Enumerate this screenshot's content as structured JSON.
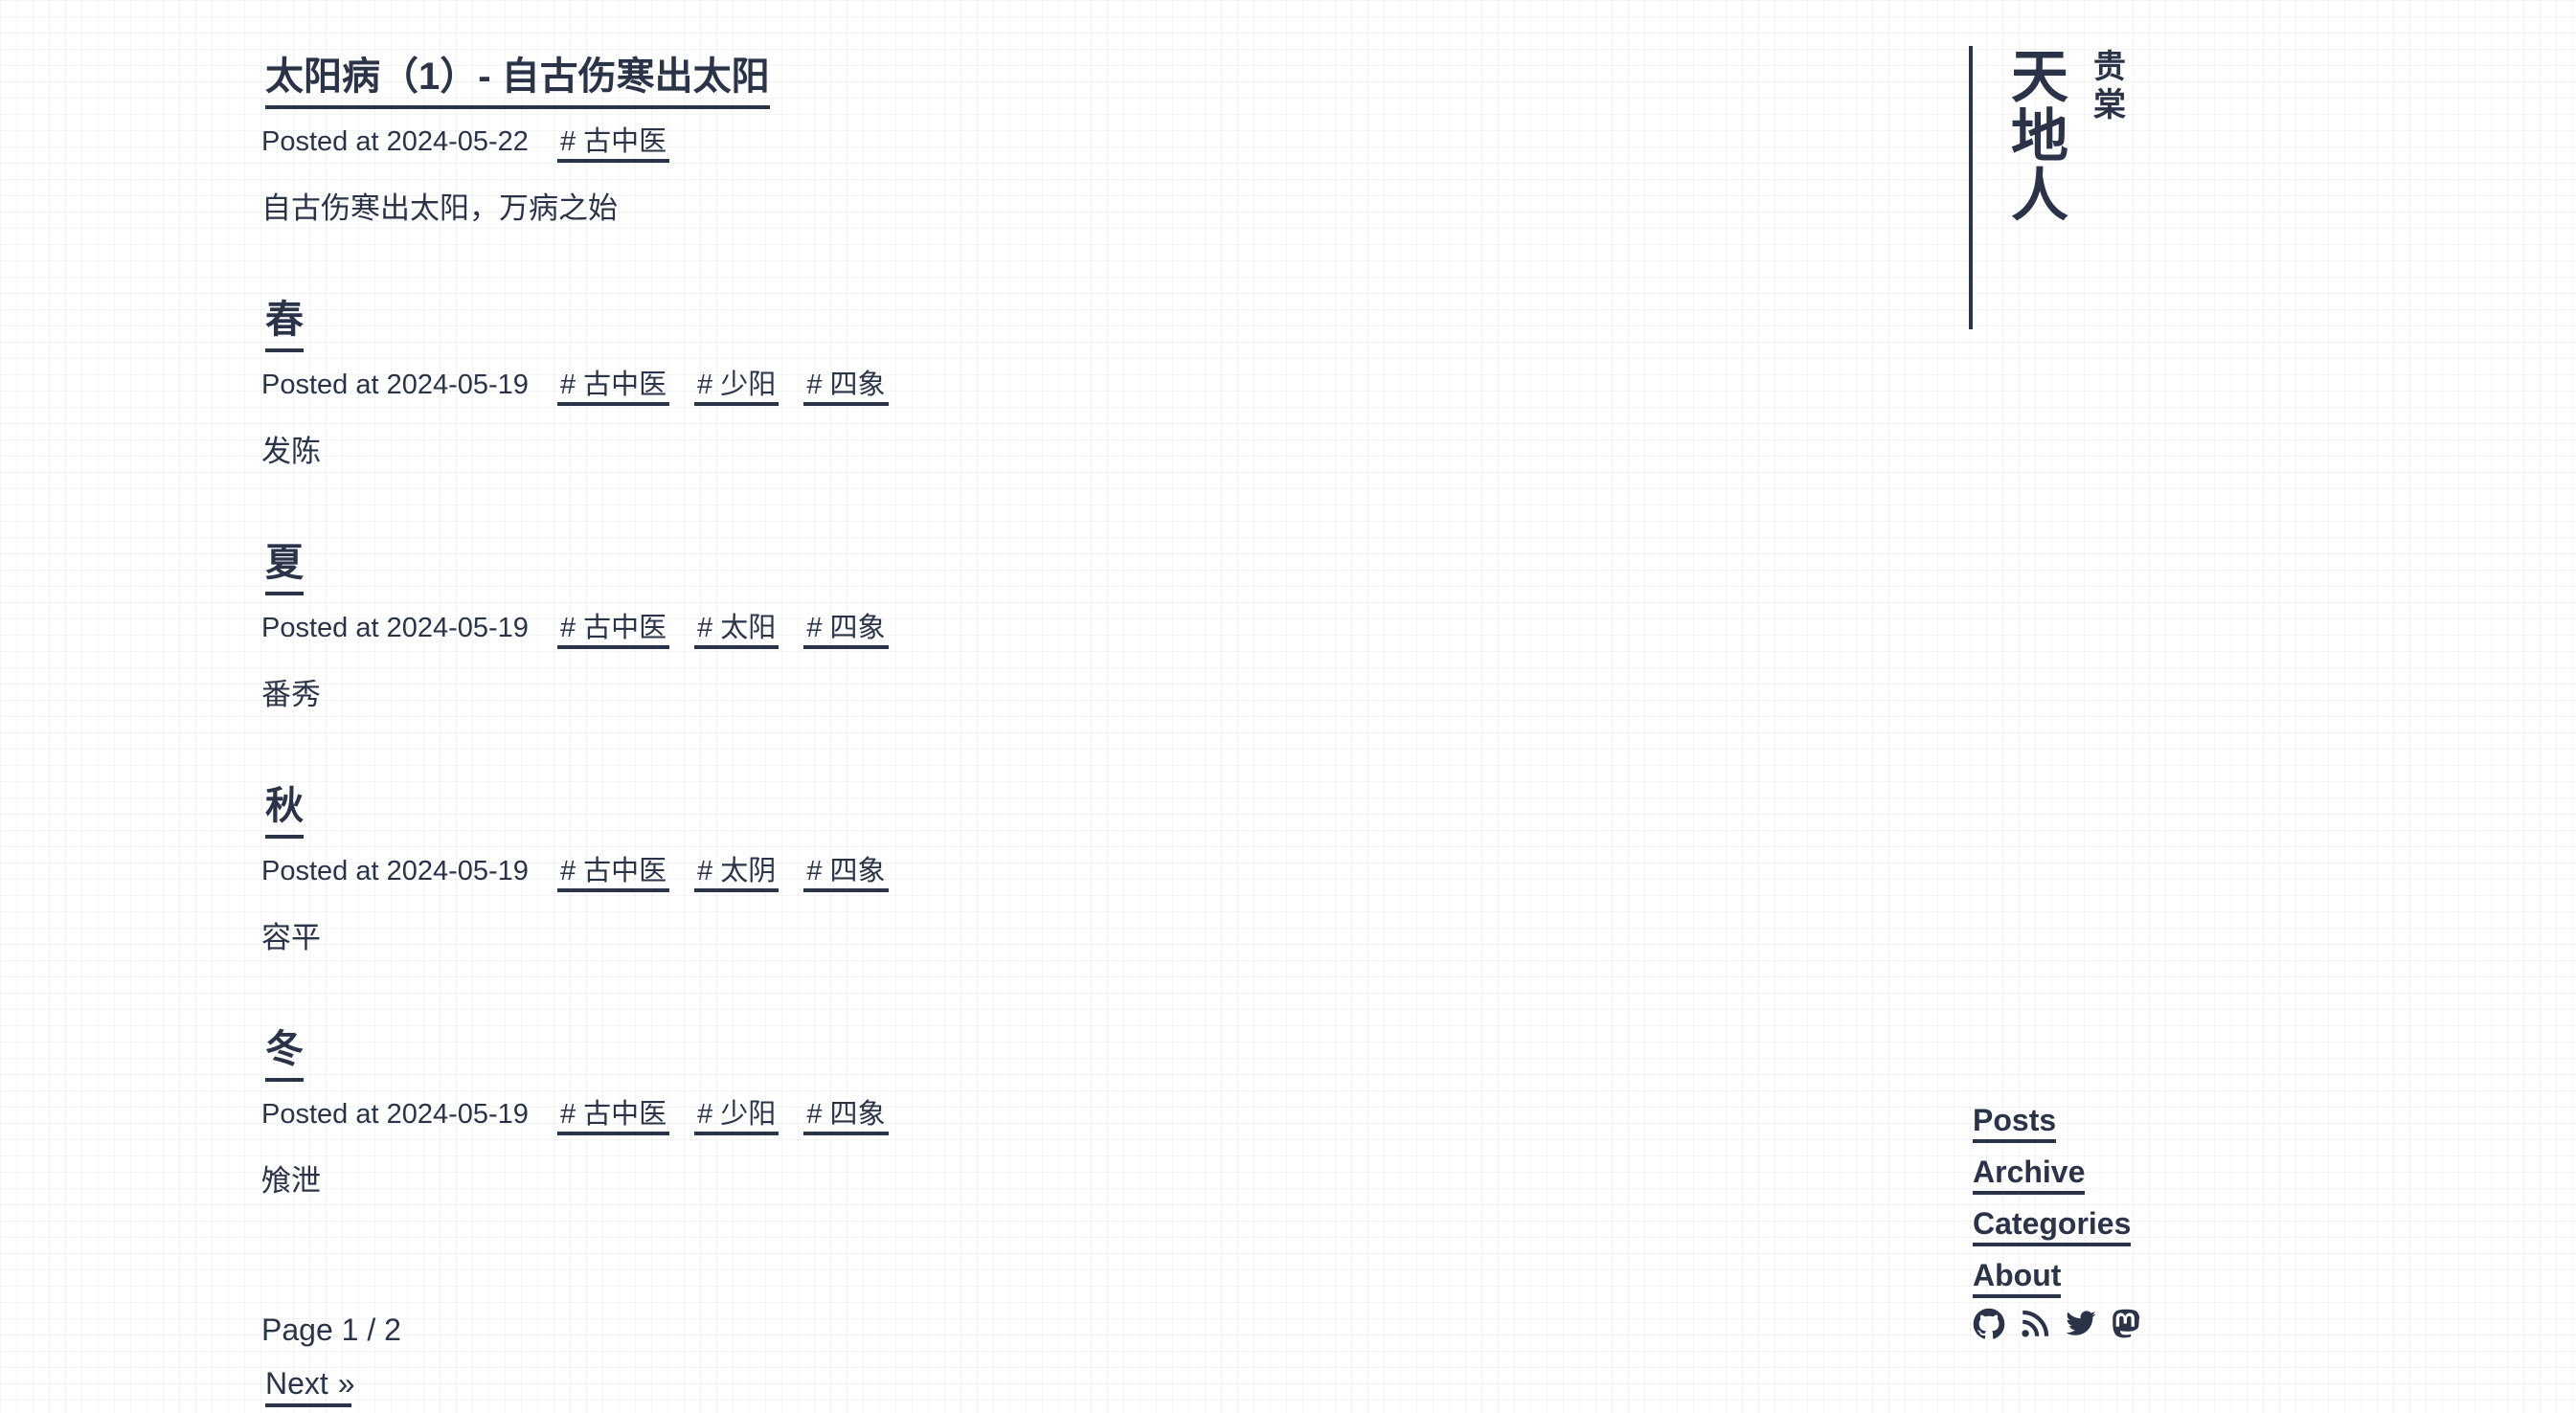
{
  "posts": [
    {
      "title": "太阳病（1）- 自古伤寒出太阳",
      "date_label": "Posted at 2024-05-22",
      "tags": [
        "# 古中医"
      ],
      "summary": "自古伤寒出太阳，万病之始"
    },
    {
      "title": "春",
      "date_label": "Posted at 2024-05-19",
      "tags": [
        "# 古中医",
        "# 少阳",
        "# 四象"
      ],
      "summary": "发陈"
    },
    {
      "title": "夏",
      "date_label": "Posted at 2024-05-19",
      "tags": [
        "# 古中医",
        "# 太阳",
        "# 四象"
      ],
      "summary": "番秀"
    },
    {
      "title": "秋",
      "date_label": "Posted at 2024-05-19",
      "tags": [
        "# 古中医",
        "# 太阴",
        "# 四象"
      ],
      "summary": "容平"
    },
    {
      "title": "冬",
      "date_label": "Posted at 2024-05-19",
      "tags": [
        "# 古中医",
        "# 少阳",
        "# 四象"
      ],
      "summary": "飧泄"
    }
  ],
  "pager": {
    "page_info": "Page 1 / 2",
    "next_label": "Next",
    "next_chevron": "»"
  },
  "site": {
    "name_chars": [
      "天",
      "地",
      "人"
    ],
    "sub_chars": [
      "贵",
      "棠"
    ]
  },
  "nav": {
    "items": [
      "Posts",
      "Archive",
      "Categories",
      "About"
    ]
  },
  "social_icons": [
    "github-icon",
    "rss-icon",
    "twitter-icon",
    "mastodon-icon"
  ],
  "colors": {
    "text": "#2b3349",
    "background": "#ffffff"
  }
}
